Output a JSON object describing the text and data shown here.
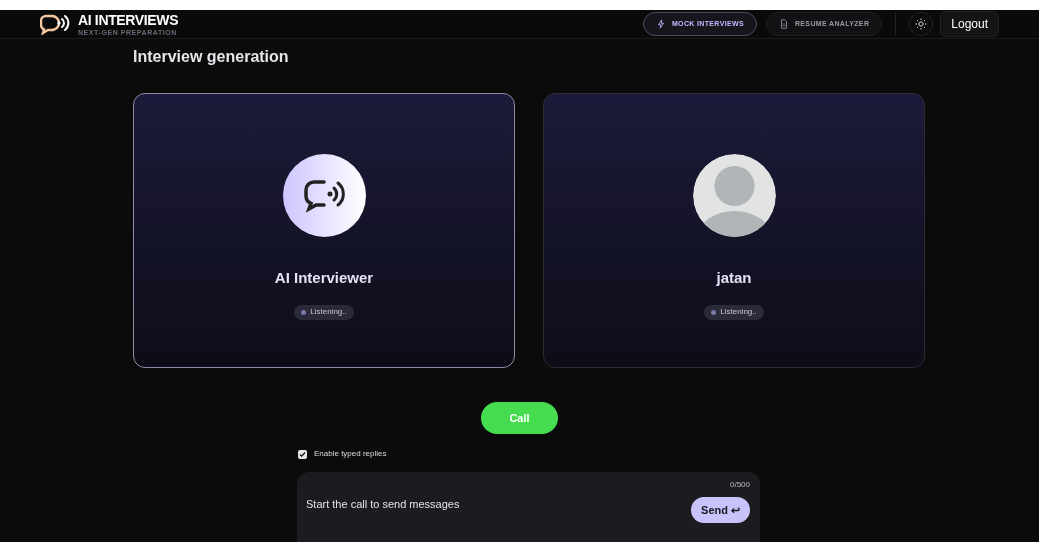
{
  "brand": {
    "title": "AI INTERVIEWS",
    "subtitle": "NEXT-GEN PREPARATION"
  },
  "nav": [
    {
      "label": "MOCK INTERVIEWS",
      "kind": "bolt",
      "selected": true
    },
    {
      "label": "RESUME ANALYZER",
      "kind": "document",
      "selected": false
    }
  ],
  "logout": "Logout",
  "heading": "Interview generation",
  "participants": [
    {
      "name": "AI Interviewer",
      "kind": "ai",
      "status": "Listening..",
      "active": true
    },
    {
      "name": "jatan",
      "kind": "user",
      "status": "Listening..",
      "active": false
    }
  ],
  "call_button": "Call",
  "typed_replies": {
    "label": "Enable typed replies",
    "checked": true
  },
  "message": {
    "placeholder": "Start the call to send messages",
    "counter": "0/500",
    "send": "Send ↩"
  }
}
